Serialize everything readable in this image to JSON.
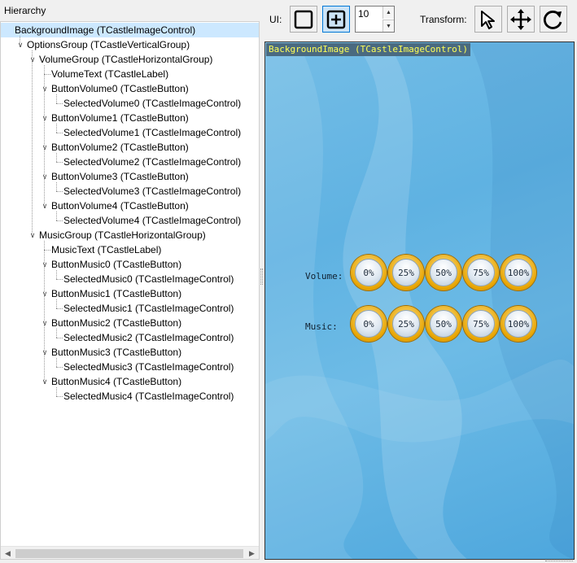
{
  "hierarchy": {
    "title": "Hierarchy",
    "nodes": [
      {
        "label": "BackgroundImage (TCastleImageControl)",
        "depth": 0,
        "expanded": true,
        "selected": true
      },
      {
        "label": "OptionsGroup (TCastleVerticalGroup)",
        "depth": 1,
        "expanded": true
      },
      {
        "label": "VolumeGroup (TCastleHorizontalGroup)",
        "depth": 2,
        "expanded": true
      },
      {
        "label": "VolumeText (TCastleLabel)",
        "depth": 3
      },
      {
        "label": "ButtonVolume0 (TCastleButton)",
        "depth": 3,
        "expanded": true
      },
      {
        "label": "SelectedVolume0 (TCastleImageControl)",
        "depth": 4
      },
      {
        "label": "ButtonVolume1 (TCastleButton)",
        "depth": 3,
        "expanded": true
      },
      {
        "label": "SelectedVolume1 (TCastleImageControl)",
        "depth": 4
      },
      {
        "label": "ButtonVolume2 (TCastleButton)",
        "depth": 3,
        "expanded": true
      },
      {
        "label": "SelectedVolume2 (TCastleImageControl)",
        "depth": 4
      },
      {
        "label": "ButtonVolume3 (TCastleButton)",
        "depth": 3,
        "expanded": true
      },
      {
        "label": "SelectedVolume3 (TCastleImageControl)",
        "depth": 4
      },
      {
        "label": "ButtonVolume4 (TCastleButton)",
        "depth": 3,
        "expanded": true
      },
      {
        "label": "SelectedVolume4 (TCastleImageControl)",
        "depth": 4
      },
      {
        "label": "MusicGroup (TCastleHorizontalGroup)",
        "depth": 2,
        "expanded": true
      },
      {
        "label": "MusicText (TCastleLabel)",
        "depth": 3
      },
      {
        "label": "ButtonMusic0 (TCastleButton)",
        "depth": 3,
        "expanded": true
      },
      {
        "label": "SelectedMusic0 (TCastleImageControl)",
        "depth": 4
      },
      {
        "label": "ButtonMusic1 (TCastleButton)",
        "depth": 3,
        "expanded": true
      },
      {
        "label": "SelectedMusic1 (TCastleImageControl)",
        "depth": 4
      },
      {
        "label": "ButtonMusic2 (TCastleButton)",
        "depth": 3,
        "expanded": true
      },
      {
        "label": "SelectedMusic2 (TCastleImageControl)",
        "depth": 4
      },
      {
        "label": "ButtonMusic3 (TCastleButton)",
        "depth": 3,
        "expanded": true
      },
      {
        "label": "SelectedMusic3 (TCastleImageControl)",
        "depth": 4
      },
      {
        "label": "ButtonMusic4 (TCastleButton)",
        "depth": 3,
        "expanded": true
      },
      {
        "label": "SelectedMusic4 (TCastleImageControl)",
        "depth": 4
      }
    ]
  },
  "toolbar": {
    "ui_label": "UI:",
    "ui_tools": [
      {
        "name": "select-rect-tool",
        "icon": "rectangle-icon",
        "active": false
      },
      {
        "name": "add-control-tool",
        "icon": "plus-box-icon",
        "active": true
      }
    ],
    "spin_value": "10",
    "transform_label": "Transform:",
    "transform_tools": [
      {
        "name": "select-tool",
        "icon": "cursor-arrow-icon"
      },
      {
        "name": "move-tool",
        "icon": "move-arrows-icon"
      },
      {
        "name": "rotate-tool",
        "icon": "rotate-icon"
      }
    ]
  },
  "viewport": {
    "selected_label": "BackgroundImage (TCastleImageControl)",
    "volume": {
      "label": "Volume:",
      "buttons": [
        "0%",
        "25%",
        "50%",
        "75%",
        "100%"
      ]
    },
    "music": {
      "label": "Music:",
      "buttons": [
        "0%",
        "25%",
        "50%",
        "75%",
        "100%"
      ]
    }
  },
  "colors": {
    "selection_bg": "#cce8ff",
    "viewport_blue": "#5fb2e2",
    "label_text": "#ffff55",
    "button_ring": "#e8a400"
  }
}
